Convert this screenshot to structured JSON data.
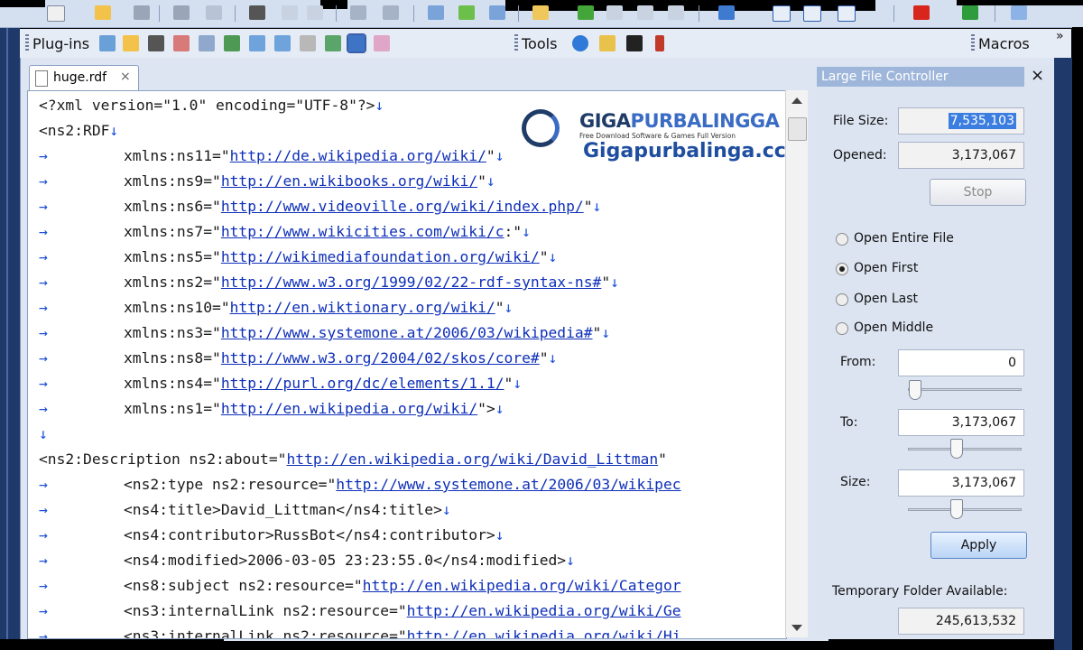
{
  "toolbar2": {
    "plugins_label": "Plug-ins",
    "tools_label": "Tools",
    "macros_label": "Macros",
    "overflow": "»"
  },
  "tab": {
    "name": "huge.rdf",
    "close": "×"
  },
  "watermark": {
    "brand_a": "GIGA",
    "brand_b": "PURBALINGGA",
    "tagline": "Free Download Software & Games Full Version",
    "site": "Gigapurbalinga.cc"
  },
  "editor": {
    "lines": [
      {
        "ind": false,
        "pre": "<?xml version=\"1.0\" encoding=\"UTF-8\"?>",
        "link": "",
        "post": "",
        "eol": "↓"
      },
      {
        "ind": false,
        "pre": "<ns2:RDF",
        "link": "",
        "post": "",
        "eol": "↓"
      },
      {
        "ind": true,
        "pre": "xmlns:ns11=\"",
        "link": "http://de.wikipedia.org/wiki/",
        "post": "\"",
        "eol": "↓"
      },
      {
        "ind": true,
        "pre": "xmlns:ns9=\"",
        "link": "http://en.wikibooks.org/wiki/",
        "post": "\"",
        "eol": "↓"
      },
      {
        "ind": true,
        "pre": "xmlns:ns6=\"",
        "link": "http://www.videoville.org/wiki/index.php/",
        "post": "\"",
        "eol": "↓"
      },
      {
        "ind": true,
        "pre": "xmlns:ns7=\"",
        "link": "http://www.wikicities.com/wiki/c",
        "post": ":\"",
        "eol": "↓"
      },
      {
        "ind": true,
        "pre": "xmlns:ns5=\"",
        "link": "http://wikimediafoundation.org/wiki/",
        "post": "\"",
        "eol": "↓"
      },
      {
        "ind": true,
        "pre": "xmlns:ns2=\"",
        "link": "http://www.w3.org/1999/02/22-rdf-syntax-ns#",
        "post": "\"",
        "eol": "↓"
      },
      {
        "ind": true,
        "pre": "xmlns:ns10=\"",
        "link": "http://en.wiktionary.org/wiki/",
        "post": "\"",
        "eol": "↓"
      },
      {
        "ind": true,
        "pre": "xmlns:ns3=\"",
        "link": "http://www.systemone.at/2006/03/wikipedia#",
        "post": "\"",
        "eol": "↓"
      },
      {
        "ind": true,
        "pre": "xmlns:ns8=\"",
        "link": "http://www.w3.org/2004/02/skos/core#",
        "post": "\"",
        "eol": "↓"
      },
      {
        "ind": true,
        "pre": "xmlns:ns4=\"",
        "link": "http://purl.org/dc/elements/1.1/",
        "post": "\"",
        "eol": "↓"
      },
      {
        "ind": true,
        "pre": "xmlns:ns1=\"",
        "link": "http://en.wikipedia.org/wiki/",
        "post": "\">",
        "eol": "↓"
      },
      {
        "ind": false,
        "pre": "",
        "link": "",
        "post": "",
        "eol": "↓"
      },
      {
        "ind": false,
        "pre": "<ns2:Description ns2:about=\"",
        "link": "http://en.wikipedia.org/wiki/David_Littman",
        "post": "\"",
        "eol": ""
      },
      {
        "ind": true,
        "pre": "<ns2:type ns2:resource=\"",
        "link": "http://www.systemone.at/2006/03/wikipec",
        "post": "",
        "eol": ""
      },
      {
        "ind": true,
        "pre": "<ns4:title>David_Littman</ns4:title>",
        "link": "",
        "post": "",
        "eol": "↓"
      },
      {
        "ind": true,
        "pre": "<ns4:contributor>RussBot</ns4:contributor>",
        "link": "",
        "post": "",
        "eol": "↓"
      },
      {
        "ind": true,
        "pre": "<ns4:modified>2006-03-05 23:23:55.0</ns4:modified>",
        "link": "",
        "post": "",
        "eol": "↓"
      },
      {
        "ind": true,
        "pre": "<ns8:subject ns2:resource=\"",
        "link": "http://en.wikipedia.org/wiki/Categor",
        "post": "",
        "eol": ""
      },
      {
        "ind": true,
        "pre": "<ns3:internalLink ns2:resource=\"",
        "link": "http://en.wikipedia.org/wiki/Ge",
        "post": "",
        "eol": ""
      },
      {
        "ind": true,
        "pre": "<ns3:internalLink ns2:resource=\"",
        "link": "http://en.wikipedia.org/wiki/Hi",
        "post": "",
        "eol": ""
      }
    ]
  },
  "panel": {
    "title": "Large File Controller",
    "close": "×",
    "file_size_label": "File Size:",
    "file_size_value": "7,535,103",
    "opened_label": "Opened:",
    "opened_value": "3,173,067",
    "stop_label": "Stop",
    "options": [
      "Open Entire File",
      "Open First",
      "Open Last",
      "Open Middle"
    ],
    "selected_option": "Open First",
    "from_label": "From:",
    "from_value": "0",
    "to_label": "To:",
    "to_value": "3,173,067",
    "size_label": "Size:",
    "size_value": "3,173,067",
    "apply_label": "Apply",
    "temp_label": "Temporary Folder Available:",
    "temp_value": "245,613,532"
  }
}
